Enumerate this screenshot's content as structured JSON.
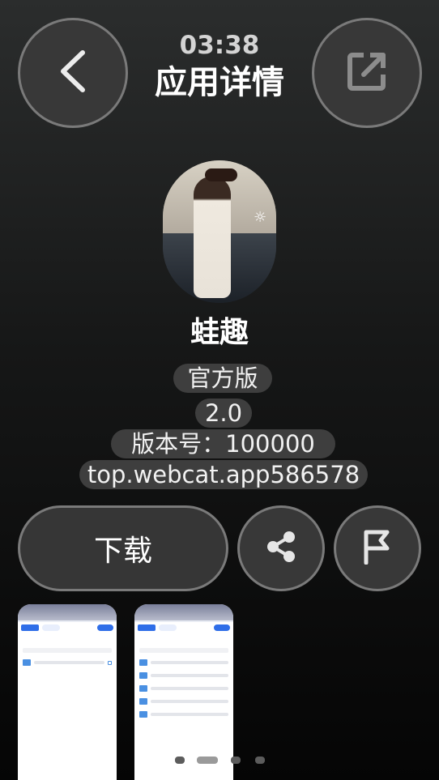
{
  "header": {
    "time": "03:38",
    "title": "应用详情"
  },
  "app": {
    "name": "蛙趣",
    "edition": "官方版",
    "version": "2.0",
    "version_code": "版本号：100000",
    "package": "top.webcat.app586578"
  },
  "actions": {
    "download_label": "下载"
  },
  "icons": {
    "back": "chevron-left-icon",
    "open_external": "open-external-icon",
    "share": "share-icon",
    "report": "flag-icon"
  },
  "colors": {
    "button_bg": "#383838",
    "button_border": "#7a7a7a",
    "pill_bg": "#3e3e3e"
  },
  "pager": {
    "count": 4,
    "active_index": 1
  }
}
